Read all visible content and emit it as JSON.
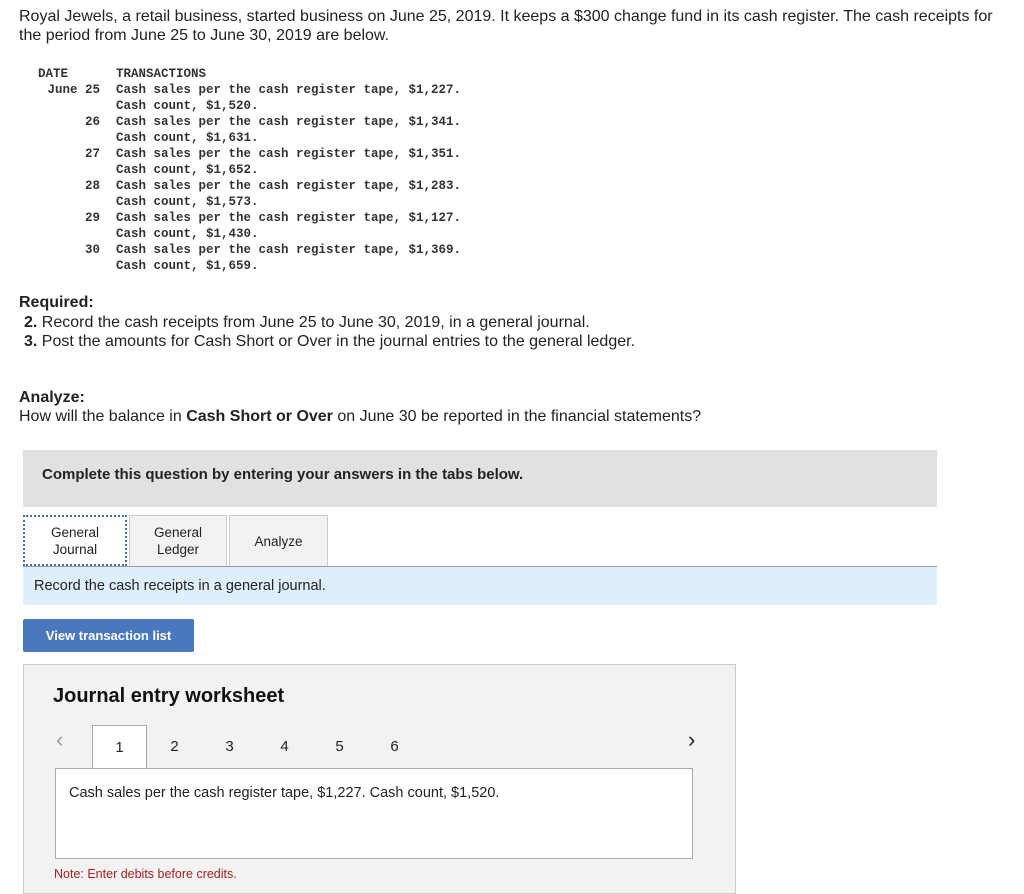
{
  "intro": "Royal Jewels, a retail business, started business on June 25, 2019. It keeps a $300 change fund in its cash register. The cash receipts for the period from June 25 to June 30, 2019 are below.",
  "transactions": {
    "headers": [
      "DATE",
      "TRANSACTIONS"
    ],
    "rows": [
      {
        "date": "June 25",
        "line1": "Cash sales per the cash register tape, $1,227.",
        "line2": "Cash count, $1,520."
      },
      {
        "date": "26",
        "line1": "Cash sales per the cash register tape, $1,341.",
        "line2": "Cash count, $1,631."
      },
      {
        "date": "27",
        "line1": "Cash sales per the cash register tape, $1,351.",
        "line2": "Cash count, $1,652."
      },
      {
        "date": "28",
        "line1": "Cash sales per the cash register tape, $1,283.",
        "line2": "Cash count, $1,573."
      },
      {
        "date": "29",
        "line1": "Cash sales per the cash register tape, $1,127.",
        "line2": "Cash count, $1,430."
      },
      {
        "date": "30",
        "line1": "Cash sales per the cash register tape, $1,369.",
        "line2": "Cash count, $1,659."
      }
    ]
  },
  "required": {
    "label": "Required:",
    "items": [
      {
        "num": "2.",
        "text": "Record the cash receipts from June 25 to June 30, 2019, in a general journal."
      },
      {
        "num": "3.",
        "text": "Post the amounts for Cash Short or Over in the journal entries to the general ledger."
      }
    ]
  },
  "analyze": {
    "label": "Analyze:",
    "pre": "How will the balance in ",
    "bold": "Cash Short or Over",
    "post": " on June 30 be reported in the financial statements?"
  },
  "banner": "Complete this question by entering your answers in the tabs below.",
  "tabs": [
    {
      "l1": "General",
      "l2": "Journal"
    },
    {
      "l1": "General",
      "l2": "Ledger"
    },
    {
      "l1": "Analyze"
    }
  ],
  "instruction": "Record the cash receipts in a general journal.",
  "view_button": "View transaction list",
  "worksheet": {
    "title": "Journal entry worksheet",
    "pages": [
      "1",
      "2",
      "3",
      "4",
      "5",
      "6"
    ],
    "prev": "‹",
    "next": "›",
    "content": "Cash sales per the cash register tape, $1,227. Cash count, $1,520.",
    "note": "Note: Enter debits before credits."
  },
  "colors": {
    "button": "#4a78bd",
    "info_bar": "#dfeefb",
    "note": "#a3231f"
  }
}
